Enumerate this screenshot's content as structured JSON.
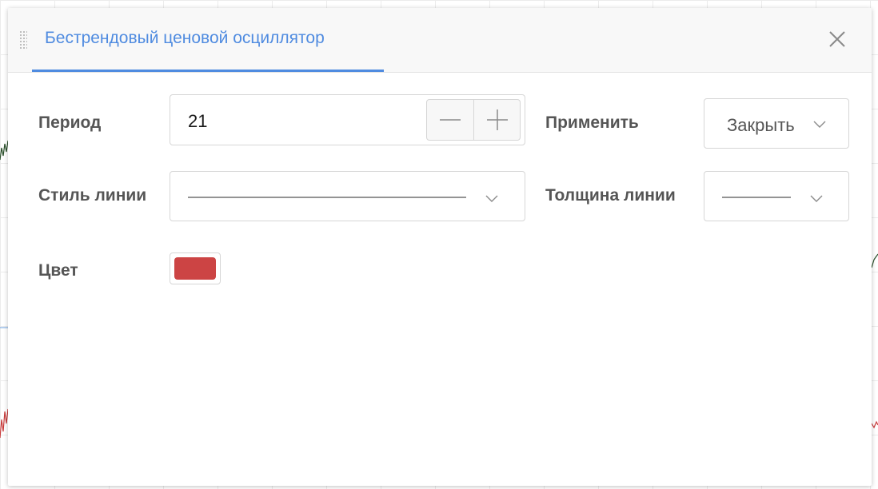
{
  "dialog": {
    "title": "Бестрендовый ценовой осциллятор",
    "close_icon": "close-icon",
    "drag_icon": "drag-handle-icon"
  },
  "fields": {
    "period": {
      "label": "Период",
      "value": "21",
      "decrement_icon": "minus-icon",
      "increment_icon": "plus-icon"
    },
    "apply": {
      "label": "Применить",
      "selected": "Закрыть"
    },
    "line_style": {
      "label": "Стиль линии",
      "selected_icon": "solid-line-icon"
    },
    "line_width": {
      "label": "Толщина линии",
      "selected_icon": "thin-line-icon"
    },
    "color": {
      "label": "Цвет",
      "value": "#cc4444"
    }
  },
  "colors": {
    "accent": "#4f8be0",
    "label": "#555555",
    "border": "#d6d6d6"
  }
}
